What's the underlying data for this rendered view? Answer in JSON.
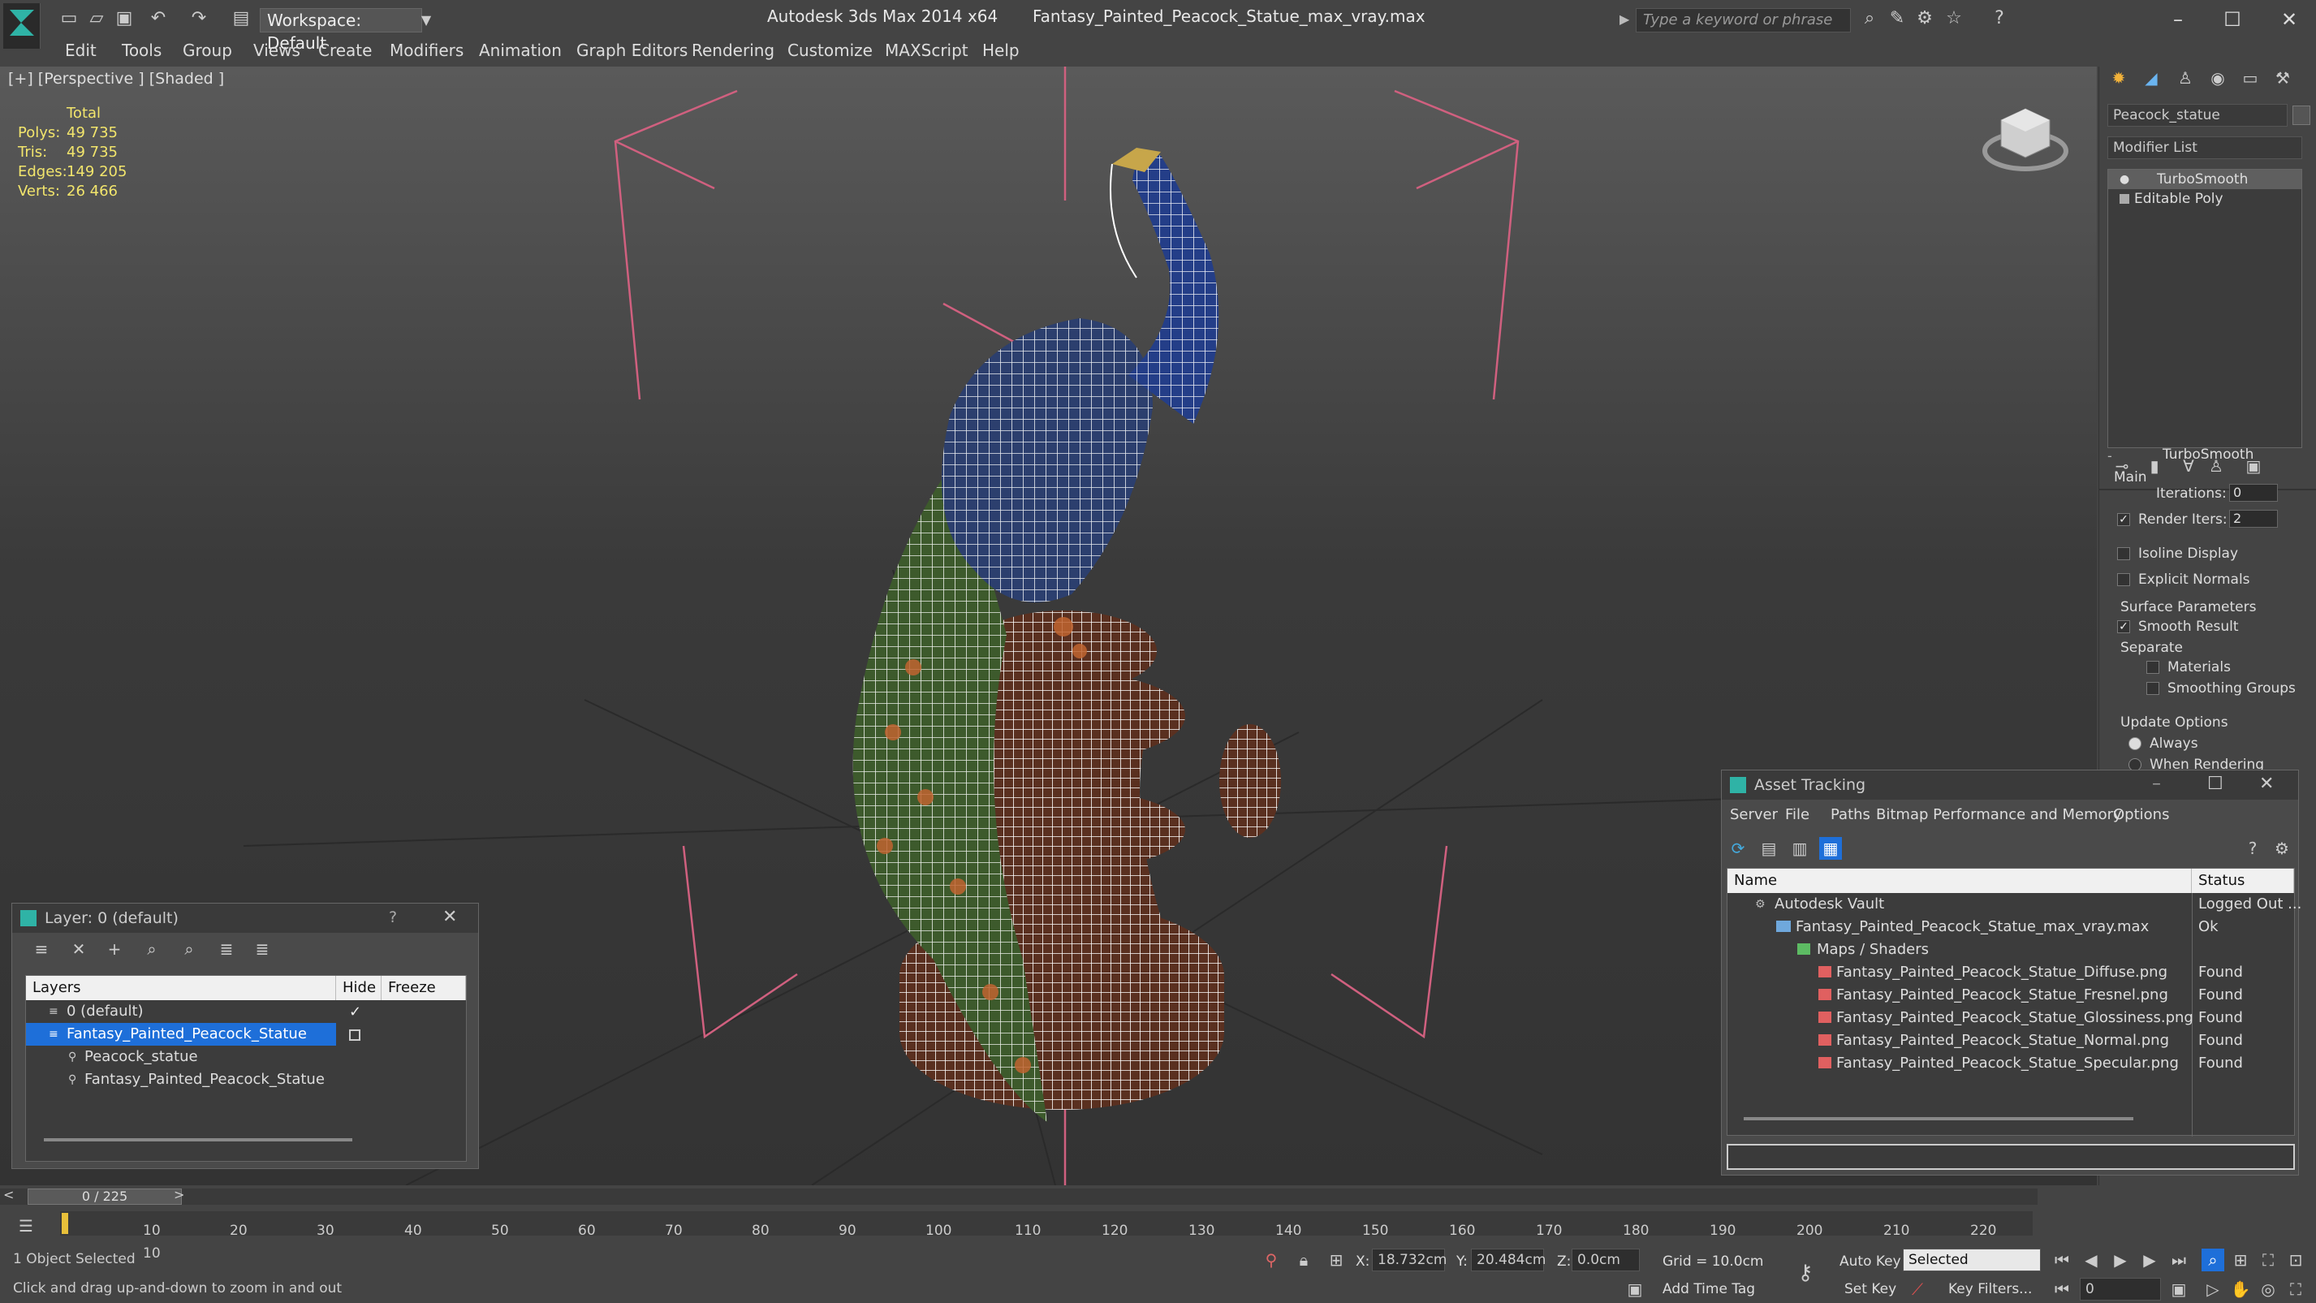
{
  "app": {
    "title": "Autodesk 3ds Max  2014 x64",
    "file_title": "Fantasy_Painted_Peacock_Statue_max_vray.max",
    "workspace": "Workspace: Default",
    "search_placeholder": "Type a keyword or phrase"
  },
  "menu": [
    "Edit",
    "Tools",
    "Group",
    "Views",
    "Create",
    "Modifiers",
    "Animation",
    "Graph Editors",
    "Rendering",
    "Customize",
    "MAXScript",
    "Help"
  ],
  "viewport": {
    "label": "[+] [Perspective ] [Shaded ]",
    "stats": {
      "header": "Total",
      "polys_label": "Polys:",
      "polys": "49 735",
      "tris_label": "Tris:",
      "tris": "49 735",
      "edges_label": "Edges:",
      "edges": "149 205",
      "verts_label": "Verts:",
      "verts": "26 466"
    }
  },
  "command_panel": {
    "object_name": "Peacock_statue",
    "modifier_list": "Modifier List",
    "stack": [
      "TurboSmooth",
      "Editable Poly"
    ],
    "rollout_title": "TurboSmooth",
    "main_label": "Main",
    "iterations_label": "Iterations:",
    "iterations": "0",
    "render_iters_label": "Render Iters:",
    "render_iters": "2",
    "isoline": "Isoline Display",
    "explicit_normals": "Explicit Normals",
    "surface_params": "Surface Parameters",
    "smooth_result": "Smooth Result",
    "separate": "Separate",
    "materials": "Materials",
    "smoothing_groups": "Smoothing Groups",
    "update_options": "Update Options",
    "always": "Always",
    "when_rendering": "When Rendering"
  },
  "layer_window": {
    "title": "Layer: 0 (default)",
    "help": "?",
    "col_layers": "Layers",
    "col_hide": "Hide",
    "col_freeze": "Freeze",
    "rows": [
      {
        "name": "0 (default)",
        "selected": false
      },
      {
        "name": "Fantasy_Painted_Peacock_Statue",
        "selected": true
      },
      {
        "name": "Peacock_statue",
        "selected": false
      },
      {
        "name": "Fantasy_Painted_Peacock_Statue",
        "selected": false
      }
    ]
  },
  "asset_tracking": {
    "title": "Asset Tracking",
    "menu": [
      "Server",
      "File",
      "Paths",
      "Bitmap Performance and Memory",
      "Options"
    ],
    "col_name": "Name",
    "col_status": "Status",
    "rows": [
      {
        "name": "Autodesk Vault",
        "status": "Logged Out ..."
      },
      {
        "name": "Fantasy_Painted_Peacock_Statue_max_vray.max",
        "status": "Ok"
      },
      {
        "name": "Maps / Shaders",
        "status": ""
      },
      {
        "name": "Fantasy_Painted_Peacock_Statue_Diffuse.png",
        "status": "Found"
      },
      {
        "name": "Fantasy_Painted_Peacock_Statue_Fresnel.png",
        "status": "Found"
      },
      {
        "name": "Fantasy_Painted_Peacock_Statue_Glossiness.png",
        "status": "Found"
      },
      {
        "name": "Fantasy_Painted_Peacock_Statue_Normal.png",
        "status": "Found"
      },
      {
        "name": "Fantasy_Painted_Peacock_Statue_Specular.png",
        "status": "Found"
      }
    ]
  },
  "timeline": {
    "frame": "0 / 225",
    "ticks": [
      "10",
      "20",
      "30",
      "40",
      "50",
      "60",
      "70",
      "80",
      "90",
      "100",
      "110",
      "120",
      "130",
      "140",
      "150",
      "160",
      "170",
      "180",
      "190",
      "200",
      "210",
      "220"
    ]
  },
  "status": {
    "selected": "1 Object Selected",
    "prompt": "Click and drag up-and-down to zoom in and out",
    "x_label": "X:",
    "x": "18.732cm",
    "y_label": "Y:",
    "y": "20.484cm",
    "z_label": "Z:",
    "z": "0.0cm",
    "grid": "Grid = 10.0cm",
    "add_time_tag": "Add Time Tag",
    "auto_key": "Auto Key",
    "selected_dropdown": "Selected",
    "set_key": "Set Key",
    "key_filters": "Key Filters...",
    "frame_field": "0"
  },
  "colors": {
    "accent": "#1e6fd9",
    "wire_white": "#ffffff",
    "bbox_pink": "#d0607f"
  }
}
